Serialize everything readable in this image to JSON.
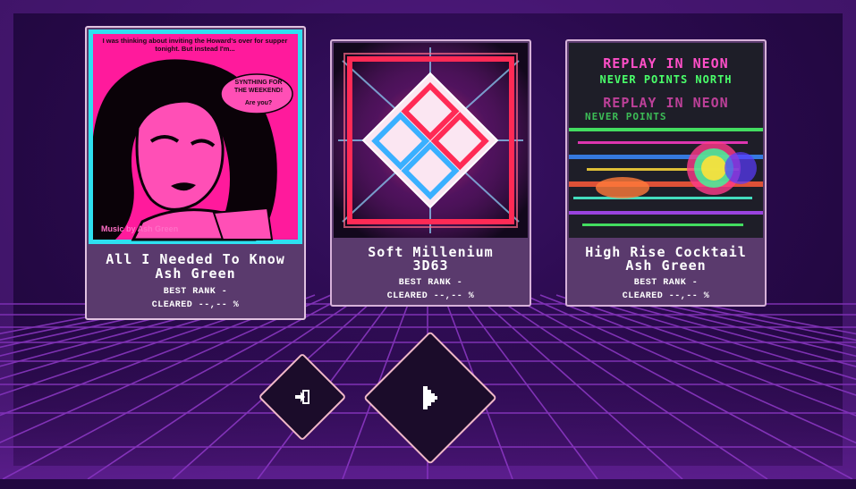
{
  "cards": [
    {
      "title": "All I Needed To Know",
      "artist": "Ash Green",
      "best_rank": "BEST RANK -",
      "cleared": "CLEARED --,-- %",
      "art": {
        "icon": "pinup-woman-comic-cover-art",
        "speech_top": "I was thinking about inviting the Howard's over for supper tonight. But instead I'm...",
        "speech_bubble": "SYNTHING FOR THE WEEKEND!",
        "speech_sub": "Are you?",
        "credit": "Music by Ash Green"
      }
    },
    {
      "title": "Soft Millenium",
      "artist": "3D63",
      "best_rank": "BEST RANK -",
      "cleared": "CLEARED --,-- %",
      "art": {
        "icon": "neon-diamond-logo-cover-art"
      }
    },
    {
      "title": "High Rise Cocktail",
      "artist": "Ash Green",
      "best_rank": "BEST RANK -",
      "cleared": "CLEARED --,-- %",
      "art": {
        "icon": "glitch-neon-cover-art",
        "line1": "REPLAY IN NEON",
        "line2": "NEVER POINTS NORTH",
        "line3": "REPLAY IN NEON",
        "line4": "NEVER POINTS"
      }
    }
  ],
  "buttons": {
    "exit_icon": "exit-door-icon",
    "play_icon": "play-icon"
  },
  "colors": {
    "background": "#2a0a4d",
    "grid": "#9b3fd6",
    "card": "#5a3a6d",
    "card_border": "#d7b2d9",
    "selected_art_border": "#2ee0f0",
    "button_border": "#f0b8c8",
    "button_fill": "#1b0c2a"
  }
}
